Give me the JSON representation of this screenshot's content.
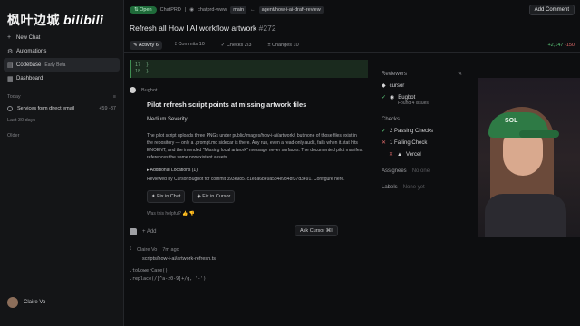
{
  "watermark": {
    "text": "枫叶边城",
    "brand": "bilibili"
  },
  "sidebar": {
    "items": [
      {
        "icon": "plus-icon",
        "label": "New Chat"
      },
      {
        "icon": "automations-icon",
        "label": "Automations"
      },
      {
        "icon": "codebase-icon",
        "label": "Codebase",
        "badge": "Early Beta"
      },
      {
        "icon": "dashboard-icon",
        "label": "Dashboard"
      }
    ],
    "today_label": "Today",
    "tasks": [
      {
        "label": "Services form direct email",
        "diff": "+59 -37"
      }
    ],
    "last30_label": "Last 30 days",
    "older_label": "Older",
    "user": "Claire Vo"
  },
  "topbar": {
    "status": "Open",
    "repo": "ChatPRD",
    "org": "chatprd-www",
    "base": "main",
    "branch": "agent/how-i-ai-draft-review",
    "add_comment": "Add Comment"
  },
  "pr": {
    "title": "Refresh all How I AI workflow artwork",
    "number": "#272",
    "tabs": [
      "Activity 6",
      "Commits 10",
      "Checks 2/3",
      "Changes 10"
    ],
    "diff_add": "+2,147",
    "diff_del": "-150"
  },
  "review": {
    "author": "Bugbot",
    "title": "Pilot refresh script points at missing artwork files",
    "severity": "Medium Severity",
    "body": "The pilot script uploads three PNGs under public/images/how-i-ai/artwork/, but none of those files exist in the repository — only a .prompt.md sidecar is there. Any run, even a read-only audit, fails when it.stat hits ENOENT, and the intended \"Missing local artwork\" message never surfaces. The documented pilot manifest references the same nonexistent assets.",
    "additional": "Additional Locations (1)",
    "reviewed": "Reviewed by Cursor Bugbot for commit 393e9857c1e8a6be9a5b4e9348f37d3491. Configure here.",
    "fix_chat": "Fix in Chat",
    "fix_cursor": "Fix in Cursor",
    "feedback": "Was this helpful?",
    "emoji_label": "+ Add",
    "commit_author": "Claire Vo",
    "commit_time": "7m ago",
    "commit_msg": "scripts/how-i-ai/artwork-refresh.ts",
    "code_lines": [
      "  .toLowerCase()",
      "  .replace(/[^a-z0-9]+/g, '-')"
    ],
    "ask_cursor": "Ask Cursor ⌘I"
  },
  "rpanel": {
    "reviewers_label": "Reviewers",
    "reviewers": [
      {
        "name": "cursor"
      },
      {
        "name": "Bugbot",
        "sub": "Found 4 issues"
      }
    ],
    "checks_label": "Checks",
    "checks": [
      {
        "status": "ok",
        "label": "2 Passing Checks"
      },
      {
        "status": "bad",
        "label": "1 Failing Check"
      },
      {
        "status": "bad",
        "label": "Vercel"
      }
    ],
    "assignees_label": "Assignees",
    "assignees_value": "No one",
    "labels_label": "Labels",
    "labels_value": "None yet"
  },
  "colors": {
    "accent_green": "#5cc97a",
    "accent_red": "#e06b6b",
    "open_pill": "#1f6b3a"
  }
}
